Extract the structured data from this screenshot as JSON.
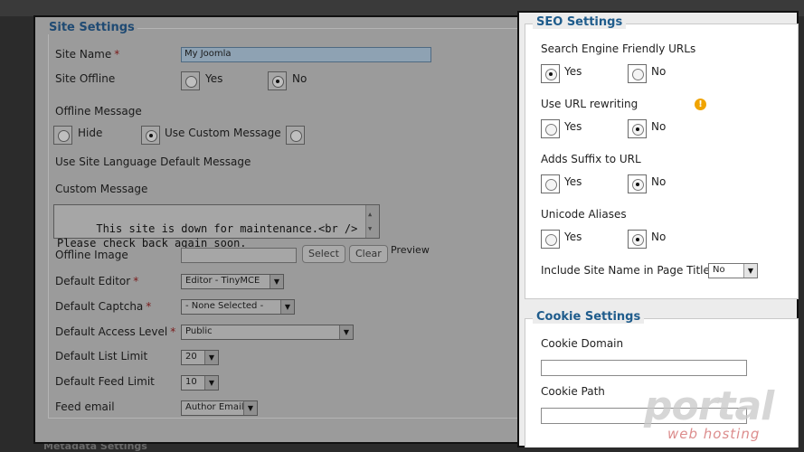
{
  "backdrop": {
    "top_fragment": "",
    "bottom_fragment": "Metadata Settings"
  },
  "site_settings": {
    "legend": "Site Settings",
    "site_name": {
      "label": "Site Name",
      "required": "*",
      "value": "My Joomla"
    },
    "site_offline": {
      "label": "Site Offline",
      "yes": "Yes",
      "no": "No",
      "selected": "No"
    },
    "offline_message": {
      "label": "Offline Message",
      "options": [
        "Hide",
        "Use Custom Message",
        ""
      ],
      "selected": "Use Custom Message"
    },
    "use_site_language_label": "Use Site Language Default Message",
    "custom_message": {
      "label": "Custom Message",
      "value": "This site is down for maintenance.<br />\nPlease check back again soon."
    },
    "offline_image": {
      "label": "Offline Image",
      "select_button": "Select",
      "clear_button": "Clear",
      "preview_label": "Preview"
    },
    "default_editor": {
      "label": "Default Editor",
      "required": "*",
      "value": "Editor - TinyMCE"
    },
    "default_captcha": {
      "label": "Default Captcha",
      "required": "*",
      "value": "- None Selected -"
    },
    "default_access_level": {
      "label": "Default Access Level",
      "required": "*",
      "value": "Public"
    },
    "default_list_limit": {
      "label": "Default List Limit",
      "value": "20"
    },
    "default_feed_limit": {
      "label": "Default Feed Limit",
      "value": "10"
    },
    "feed_email": {
      "label": "Feed email",
      "value": "Author Email"
    }
  },
  "seo_settings": {
    "legend": "SEO Settings",
    "sef_urls": {
      "label": "Search Engine Friendly URLs",
      "yes": "Yes",
      "no": "No",
      "selected": "Yes"
    },
    "url_rewriting": {
      "label": "Use URL rewriting",
      "yes": "Yes",
      "no": "No",
      "selected": "No",
      "warning_icon": "!"
    },
    "suffix": {
      "label": "Adds Suffix to URL",
      "yes": "Yes",
      "no": "No",
      "selected": "No"
    },
    "unicode": {
      "label": "Unicode Aliases",
      "yes": "Yes",
      "no": "No",
      "selected": "No"
    },
    "site_name_in_titles": {
      "label": "Include Site Name in Page Titles",
      "value": "No"
    }
  },
  "cookie_settings": {
    "legend": "Cookie Settings",
    "domain_label": "Cookie Domain",
    "domain_value": "",
    "path_label": "Cookie Path",
    "path_value": ""
  },
  "watermark": {
    "title": "portal",
    "subtitle": "web hosting"
  },
  "icons": {
    "warning": "warning-icon",
    "dropdown": "chevron-down-icon",
    "scroll_up": "arrow-up-icon",
    "scroll_down": "arrow-down-icon"
  },
  "colors": {
    "legend_blue": "#1f5c8c",
    "warning": "#f0a400",
    "highlight_border": "#111111"
  }
}
